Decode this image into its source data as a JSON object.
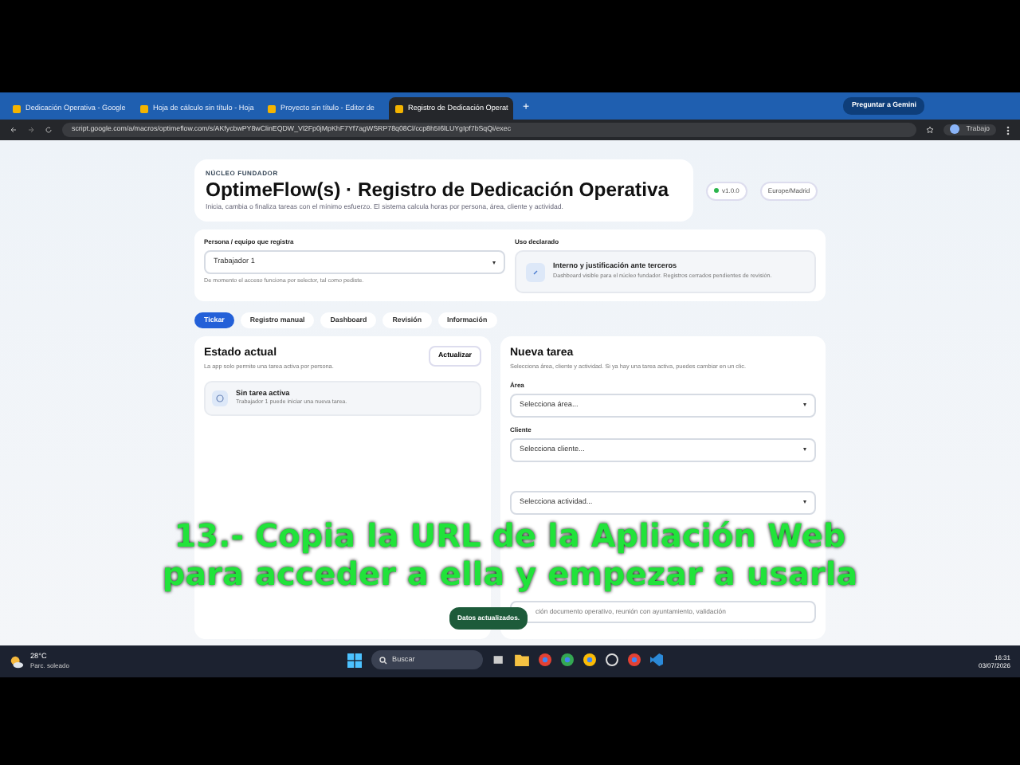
{
  "browser": {
    "tabs": [
      {
        "title": "Dedicación Operativa - Google",
        "selected": false
      },
      {
        "title": "Hoja de cálculo sin título - Hoja",
        "selected": false
      },
      {
        "title": "Proyecto sin título - Editor de",
        "selected": false
      },
      {
        "title": "Registro de Dedicación Operat",
        "selected": true
      }
    ],
    "new_tab": "+",
    "ask_button": "Preguntar a Gemini",
    "url": "script.google.com/a/macros/optimeflow.com/s/AKfycbwPY8wClinEQDW_Vl2Fp0jMpKhF7Yf7agWSRP78q08Cl/ccp8h5I6lLUYgIpf7bSqQi/exec",
    "profile": "Trabajo"
  },
  "app": {
    "eyebrow": "NÚCLEO FUNDADOR",
    "title": "OptimeFlow(s) · Registro de Dedicación Operativa",
    "subtitle": "Inicia, cambia o finaliza tareas con el mínimo esfuerzo. El sistema calcula horas por persona, área, cliente y actividad.",
    "version": "v1.0.0",
    "timezone": "Europe/Madrid",
    "person": {
      "label": "Persona / equipo que registra",
      "value": "Trabajador 1",
      "hint": "De momento el acceso funciona por selector, tal como pediste."
    },
    "usage": {
      "label": "Uso declarado",
      "title": "Interno y justificación ante terceros",
      "text": "Dashboard visible para el núcleo fundador. Registros cerrados pendientes de revisión."
    },
    "nav_tabs": [
      {
        "label": "Tickar",
        "selected": true
      },
      {
        "label": "Registro manual",
        "selected": false
      },
      {
        "label": "Dashboard",
        "selected": false
      },
      {
        "label": "Revisión",
        "selected": false
      },
      {
        "label": "Información",
        "selected": false
      }
    ],
    "status": {
      "title": "Estado actual",
      "refresh": "Actualizar",
      "note": "La app solo permite una tarea activa por persona.",
      "empty_title": "Sin tarea activa",
      "empty_text": "Trabajador 1 puede iniciar una nueva tarea."
    },
    "new_task": {
      "title": "Nueva tarea",
      "text": "Selecciona área, cliente y actividad. Si ya hay una tarea activa, puedes cambiar en un clic.",
      "fields": [
        {
          "kind": "select",
          "label": "Área",
          "value": "Selecciona área..."
        },
        {
          "kind": "select",
          "label": "Cliente",
          "value": "Selecciona cliente..."
        },
        {
          "kind": "select",
          "value": "Selecciona actividad..."
        },
        {
          "kind": "textarea",
          "placeholder": "ción documento operativo, reunión con ayuntamiento, validación"
        }
      ]
    },
    "toast": "Datos actualizados."
  },
  "caption": [
    "13.- Copia la URL de la Apliación Web",
    "para acceder a ella y empezar a usarla"
  ],
  "taskbar": {
    "weather_temp": "28°C",
    "weather_text": "Parc. soleado",
    "search": "Buscar",
    "time": "16:31",
    "date": "03/07/2026"
  }
}
